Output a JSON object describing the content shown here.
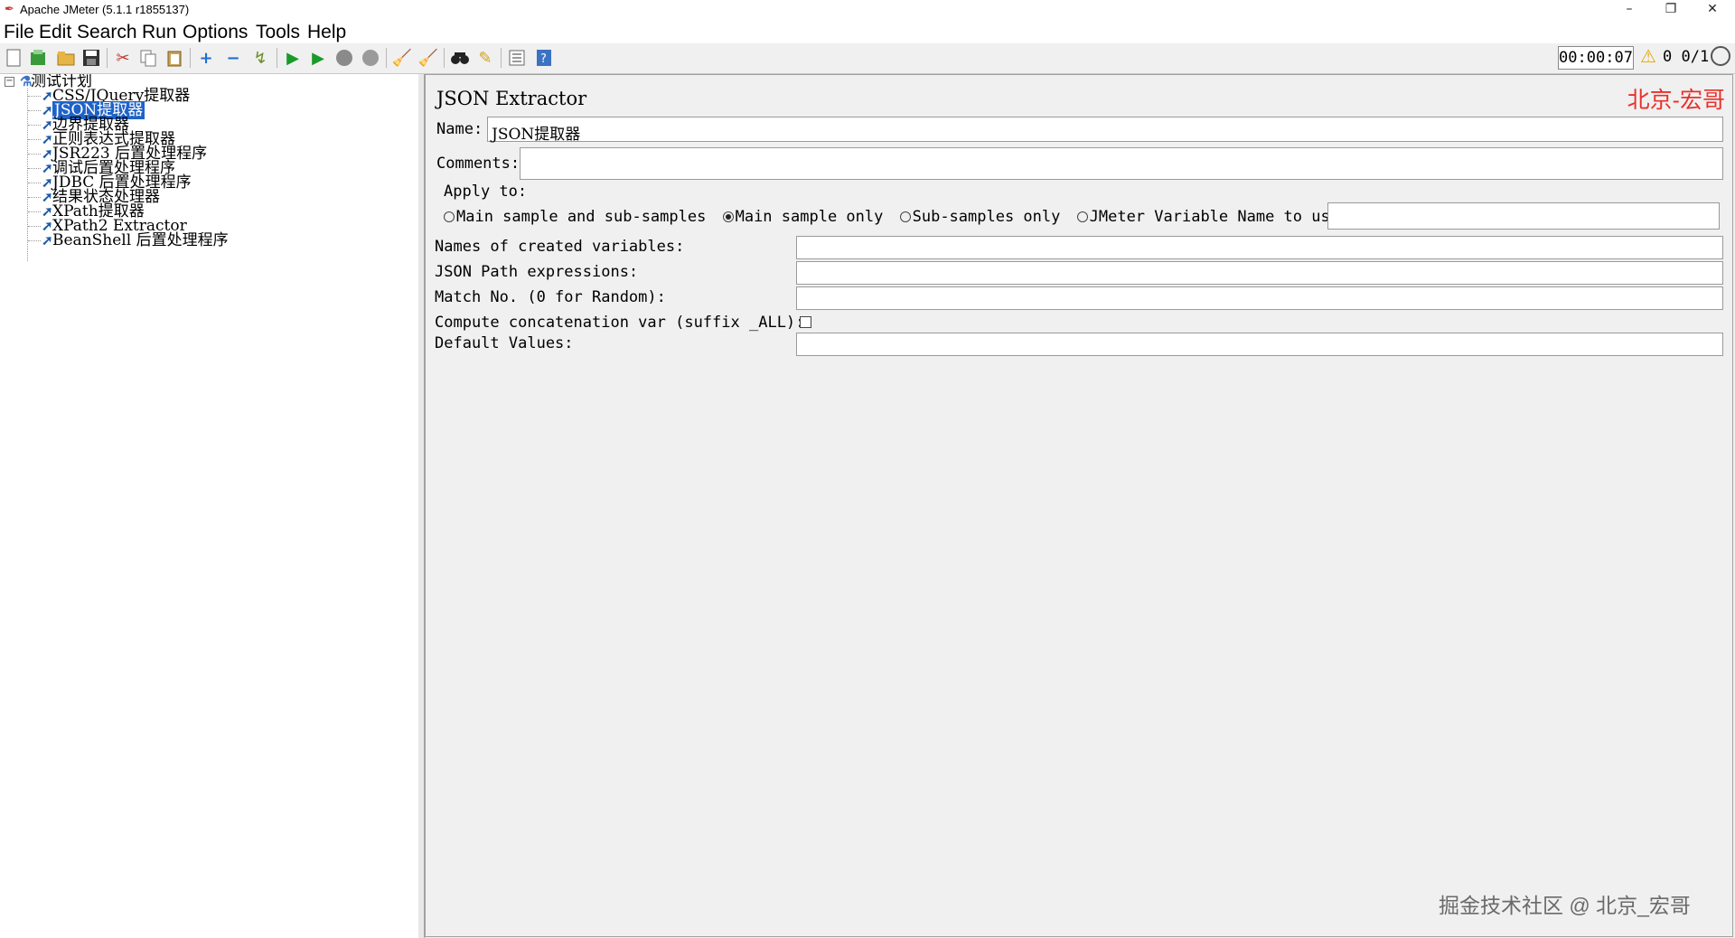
{
  "window": {
    "title": "Apache JMeter (5.1.1 r1855137)",
    "minimize_label": "–",
    "maximize_label": "❐",
    "close_label": "✕"
  },
  "menu": {
    "file": "File",
    "edit": "Edit",
    "search": "Search",
    "run": "Run",
    "options": "Options",
    "tools": "Tools",
    "help": "Help"
  },
  "toolbar": {
    "icons": [
      "new-icon",
      "templates-icon",
      "open-icon",
      "save-icon",
      "cut-icon",
      "copy-icon",
      "paste-icon",
      "expand-icon",
      "collapse-icon",
      "toggle-icon",
      "start-icon",
      "start-no-pause-icon",
      "stop-icon",
      "shutdown-icon",
      "clear-icon",
      "clear-all-icon",
      "search-icon",
      "reset-search-icon",
      "function-helper-icon",
      "help-icon"
    ],
    "timer": "00:00:07",
    "warn_count": "0",
    "threads": "0/1"
  },
  "tree": {
    "root": "测试计划",
    "items": [
      "CSS/JQuery提取器",
      "JSON提取器",
      "边界提取器",
      "正则表达式提取器",
      "JSR223 后置处理程序",
      "调试后置处理程序",
      "JDBC 后置处理程序",
      "结果状态处理器",
      "XPath提取器",
      "XPath2 Extractor",
      "BeanShell 后置处理程序"
    ],
    "selected_index": 1
  },
  "panel": {
    "title": "JSON Extractor",
    "watermark": "北京-宏哥",
    "name_label": "Name:",
    "name_value": "JSON提取器",
    "comments_label": "Comments:",
    "comments_value": "",
    "apply_to_label": "Apply to:",
    "apply_options": [
      "Main sample and sub-samples",
      "Main sample only",
      "Sub-samples only",
      "JMeter Variable Name to use"
    ],
    "apply_selected": "Main sample only",
    "variable_name_value": "",
    "names_label": "Names of created variables:",
    "names_value": "",
    "paths_label": "JSON Path expressions:",
    "paths_value": "",
    "match_label": "Match No. (0 for Random):",
    "match_value": "",
    "concat_label": "Compute concatenation var (suffix _ALL):",
    "concat_checked": false,
    "defaults_label": "Default Values:",
    "defaults_value": ""
  },
  "footer_watermark": "掘金技术社区 @ 北京_宏哥"
}
